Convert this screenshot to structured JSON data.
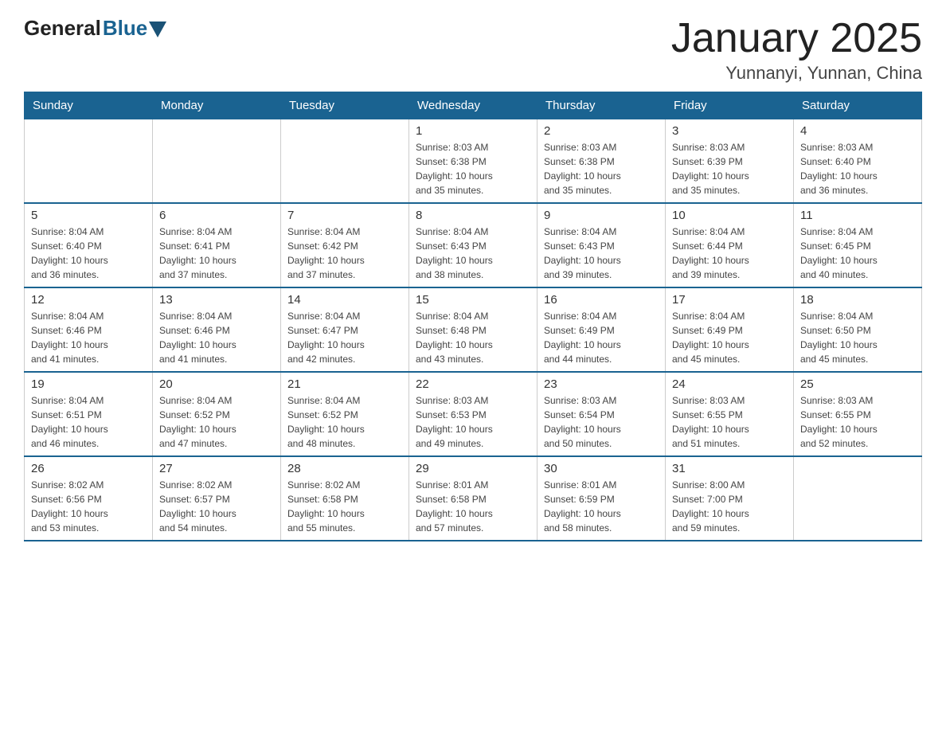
{
  "header": {
    "logo_general": "General",
    "logo_blue": "Blue",
    "month_title": "January 2025",
    "location": "Yunnanyi, Yunnan, China"
  },
  "days_of_week": [
    "Sunday",
    "Monday",
    "Tuesday",
    "Wednesday",
    "Thursday",
    "Friday",
    "Saturday"
  ],
  "weeks": [
    [
      {
        "day": "",
        "info": ""
      },
      {
        "day": "",
        "info": ""
      },
      {
        "day": "",
        "info": ""
      },
      {
        "day": "1",
        "info": "Sunrise: 8:03 AM\nSunset: 6:38 PM\nDaylight: 10 hours\nand 35 minutes."
      },
      {
        "day": "2",
        "info": "Sunrise: 8:03 AM\nSunset: 6:38 PM\nDaylight: 10 hours\nand 35 minutes."
      },
      {
        "day": "3",
        "info": "Sunrise: 8:03 AM\nSunset: 6:39 PM\nDaylight: 10 hours\nand 35 minutes."
      },
      {
        "day": "4",
        "info": "Sunrise: 8:03 AM\nSunset: 6:40 PM\nDaylight: 10 hours\nand 36 minutes."
      }
    ],
    [
      {
        "day": "5",
        "info": "Sunrise: 8:04 AM\nSunset: 6:40 PM\nDaylight: 10 hours\nand 36 minutes."
      },
      {
        "day": "6",
        "info": "Sunrise: 8:04 AM\nSunset: 6:41 PM\nDaylight: 10 hours\nand 37 minutes."
      },
      {
        "day": "7",
        "info": "Sunrise: 8:04 AM\nSunset: 6:42 PM\nDaylight: 10 hours\nand 37 minutes."
      },
      {
        "day": "8",
        "info": "Sunrise: 8:04 AM\nSunset: 6:43 PM\nDaylight: 10 hours\nand 38 minutes."
      },
      {
        "day": "9",
        "info": "Sunrise: 8:04 AM\nSunset: 6:43 PM\nDaylight: 10 hours\nand 39 minutes."
      },
      {
        "day": "10",
        "info": "Sunrise: 8:04 AM\nSunset: 6:44 PM\nDaylight: 10 hours\nand 39 minutes."
      },
      {
        "day": "11",
        "info": "Sunrise: 8:04 AM\nSunset: 6:45 PM\nDaylight: 10 hours\nand 40 minutes."
      }
    ],
    [
      {
        "day": "12",
        "info": "Sunrise: 8:04 AM\nSunset: 6:46 PM\nDaylight: 10 hours\nand 41 minutes."
      },
      {
        "day": "13",
        "info": "Sunrise: 8:04 AM\nSunset: 6:46 PM\nDaylight: 10 hours\nand 41 minutes."
      },
      {
        "day": "14",
        "info": "Sunrise: 8:04 AM\nSunset: 6:47 PM\nDaylight: 10 hours\nand 42 minutes."
      },
      {
        "day": "15",
        "info": "Sunrise: 8:04 AM\nSunset: 6:48 PM\nDaylight: 10 hours\nand 43 minutes."
      },
      {
        "day": "16",
        "info": "Sunrise: 8:04 AM\nSunset: 6:49 PM\nDaylight: 10 hours\nand 44 minutes."
      },
      {
        "day": "17",
        "info": "Sunrise: 8:04 AM\nSunset: 6:49 PM\nDaylight: 10 hours\nand 45 minutes."
      },
      {
        "day": "18",
        "info": "Sunrise: 8:04 AM\nSunset: 6:50 PM\nDaylight: 10 hours\nand 45 minutes."
      }
    ],
    [
      {
        "day": "19",
        "info": "Sunrise: 8:04 AM\nSunset: 6:51 PM\nDaylight: 10 hours\nand 46 minutes."
      },
      {
        "day": "20",
        "info": "Sunrise: 8:04 AM\nSunset: 6:52 PM\nDaylight: 10 hours\nand 47 minutes."
      },
      {
        "day": "21",
        "info": "Sunrise: 8:04 AM\nSunset: 6:52 PM\nDaylight: 10 hours\nand 48 minutes."
      },
      {
        "day": "22",
        "info": "Sunrise: 8:03 AM\nSunset: 6:53 PM\nDaylight: 10 hours\nand 49 minutes."
      },
      {
        "day": "23",
        "info": "Sunrise: 8:03 AM\nSunset: 6:54 PM\nDaylight: 10 hours\nand 50 minutes."
      },
      {
        "day": "24",
        "info": "Sunrise: 8:03 AM\nSunset: 6:55 PM\nDaylight: 10 hours\nand 51 minutes."
      },
      {
        "day": "25",
        "info": "Sunrise: 8:03 AM\nSunset: 6:55 PM\nDaylight: 10 hours\nand 52 minutes."
      }
    ],
    [
      {
        "day": "26",
        "info": "Sunrise: 8:02 AM\nSunset: 6:56 PM\nDaylight: 10 hours\nand 53 minutes."
      },
      {
        "day": "27",
        "info": "Sunrise: 8:02 AM\nSunset: 6:57 PM\nDaylight: 10 hours\nand 54 minutes."
      },
      {
        "day": "28",
        "info": "Sunrise: 8:02 AM\nSunset: 6:58 PM\nDaylight: 10 hours\nand 55 minutes."
      },
      {
        "day": "29",
        "info": "Sunrise: 8:01 AM\nSunset: 6:58 PM\nDaylight: 10 hours\nand 57 minutes."
      },
      {
        "day": "30",
        "info": "Sunrise: 8:01 AM\nSunset: 6:59 PM\nDaylight: 10 hours\nand 58 minutes."
      },
      {
        "day": "31",
        "info": "Sunrise: 8:00 AM\nSunset: 7:00 PM\nDaylight: 10 hours\nand 59 minutes."
      },
      {
        "day": "",
        "info": ""
      }
    ]
  ]
}
